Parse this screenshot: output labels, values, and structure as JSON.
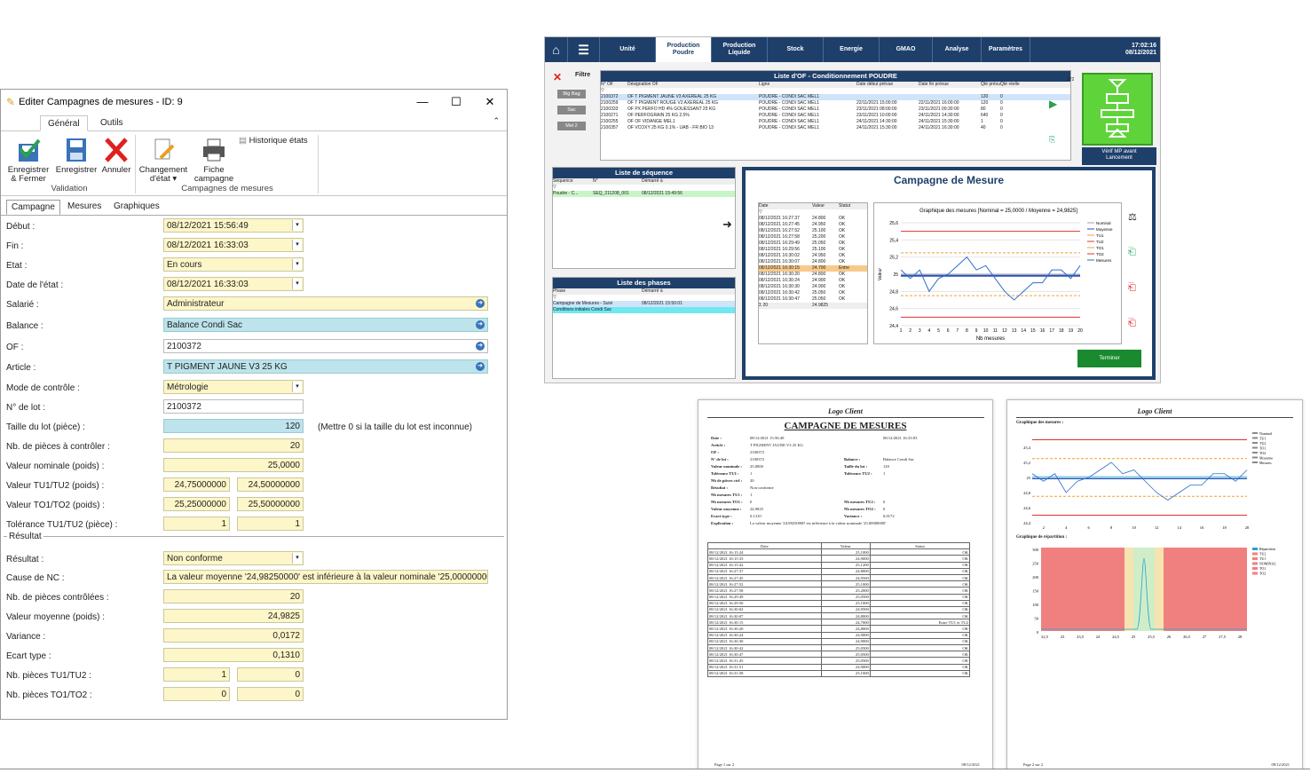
{
  "dialog": {
    "title": "Editer Campagnes de mesures - ID: 9",
    "ribbon_tabs": [
      "Général",
      "Outils"
    ],
    "buttons": {
      "save_close": "Enregistrer\n& Fermer",
      "save": "Enregistrer",
      "cancel": "Annuler",
      "change_state": "Changement\nd'état ▾",
      "campaign_sheet": "Fiche\ncampagne",
      "history": "Historique états"
    },
    "groups": {
      "validation": "Validation",
      "campaigns": "Campagnes de mesures"
    },
    "subtabs": [
      "Campagne",
      "Mesures",
      "Graphiques"
    ],
    "fields": {
      "debut": {
        "label": "Début :",
        "value": "08/12/2021 15:56:49"
      },
      "fin": {
        "label": "Fin :",
        "value": "08/12/2021 16:33:03"
      },
      "etat": {
        "label": "Etat :",
        "value": "En cours"
      },
      "date_etat": {
        "label": "Date de l'état :",
        "value": "08/12/2021 16:33:03"
      },
      "salarie": {
        "label": "Salarié :",
        "value": "Administrateur"
      },
      "balance": {
        "label": "Balance :",
        "value": "Balance Condi Sac"
      },
      "of": {
        "label": "OF :",
        "value": "2100372"
      },
      "article": {
        "label": "Article :",
        "value": "T PIGMENT JAUNE V3 25 KG"
      },
      "mode": {
        "label": "Mode de contrôle :",
        "value": "Métrologie"
      },
      "lot": {
        "label": "N° de lot :",
        "value": "2100372"
      },
      "taille": {
        "label": "Taille du lot (pièce) :",
        "value": "120",
        "hint": "(Mettre 0 si la taille du lot est inconnue)"
      },
      "nb_ctrl": {
        "label": "Nb. de pièces à contrôler :",
        "value": "20"
      },
      "nominale": {
        "label": "Valeur nominale (poids) :",
        "value": "25,0000"
      },
      "tu": {
        "label": "Valeur TU1/TU2 (poids) :",
        "v1": "24,75000000",
        "v2": "24,50000000"
      },
      "to": {
        "label": "Valeur TO1/TO2 (poids) :",
        "v1": "25,25000000",
        "v2": "25,50000000"
      },
      "tol": {
        "label": "Tolérance TU1/TU2 (pièce) :",
        "v1": "1",
        "v2": "1"
      }
    },
    "result_section": "Résultat",
    "results": {
      "resultat": {
        "label": "Résultat :",
        "value": "Non conforme"
      },
      "cause": {
        "label": "Cause de NC :",
        "value": "La valeur moyenne '24,98250000' est inférieure à la valeur nominale '25,00000000'."
      },
      "nb_ctrl": {
        "label": "Nb. de pièces contrôlées :",
        "value": "20"
      },
      "moy": {
        "label": "Valeur moyenne (poids) :",
        "value": "24,9825"
      },
      "var": {
        "label": "Variance :",
        "value": "0,0172"
      },
      "ecart": {
        "label": "Ecart type :",
        "value": "0,1310"
      },
      "ptu": {
        "label": "Nb. pièces TU1/TU2 :",
        "v1": "1",
        "v2": "0"
      },
      "pto": {
        "label": "Nb. pièces TO1/TO2 :",
        "v1": "0",
        "v2": "0"
      }
    }
  },
  "app": {
    "nav": [
      "Unité",
      "Production\nPoudre",
      "Production\nLiquide",
      "Stock",
      "Energie",
      "GMAO",
      "Analyse",
      "Paramètres"
    ],
    "clock": "17:02:16\n08/12/2021",
    "filter": "Filtre",
    "filter_btns": [
      "Big Bag",
      "Sac",
      "Mel 2"
    ],
    "of_title": "Liste d'OF - Conditionnement POUDRE",
    "of_cols": [
      "N° OF",
      "Désignation OF",
      "Ligne",
      "Date début prévue",
      "Date fin prévue",
      "Qté prévu...",
      "Qté réelle..."
    ],
    "of_rows": [
      [
        "2100372",
        "OF T PIGMENT JAUNE V3 AXEREAL 25 KG",
        "POUDRE - CONDI SAC MEL1",
        "",
        "",
        "120",
        "0"
      ],
      [
        "2100259",
        "OF T PIGMENT ROUGE V2 AXEREAL 25 KG",
        "POUDRE - CONDI SAC MEL1",
        "22/11/2021 15:00:00",
        "22/11/2021 16:00:00",
        "120",
        "0"
      ],
      [
        "2100333",
        "OF PX PERFO HD 4% GOUESSANT 25 KG",
        "POUDRE - CONDI SAC MEL1",
        "23/11/2021 08:00:00",
        "23/11/2021 09:30:00",
        "80",
        "0"
      ],
      [
        "2100271",
        "OF PERFOGRAIN 25 KG 2.5%",
        "POUDRE - CONDI SAC MEL1",
        "23/11/2021 10:00:00",
        "24/11/2021 14:30:00",
        "640",
        "0"
      ],
      [
        "2100255",
        "OF OF VIDANGE MEL1",
        "POUDRE - CONDI SAC MEL1",
        "24/11/2021 14:30:00",
        "24/11/2021 15:30:00",
        "1",
        "0"
      ],
      [
        "2100357",
        "OF VCOXY 25 KG 0.1% - UAB - FR BIO 13",
        "POUDRE - CONDI SAC MEL1",
        "24/11/2021 15:30:00",
        "24/11/2021 16:30:00",
        "40",
        "0"
      ]
    ],
    "of_count": "372",
    "verif": "Vérif MP avant\nLancement",
    "seq_title": "Liste de séquence",
    "seq_cols": [
      "Séquence",
      "N°",
      "Démarré à"
    ],
    "seq_row": [
      "Poudre - C...",
      "SEQ_211208_001",
      "08/12/2021 15:49:56"
    ],
    "phase_title": "Liste des phases",
    "phase_cols": [
      "Phase",
      "Démarré à"
    ],
    "phase_rows": [
      [
        "Campagne de Mesures - Suivi",
        "08/12/2021 15:50:01"
      ],
      [
        "Conditions initiales Condi Sac",
        ""
      ]
    ],
    "camp_title": "Campagne de Mesure",
    "meas_cols": [
      "Date",
      "Valeur",
      "Statut"
    ],
    "meas_rows": [
      [
        "08/12/2021 16:27:37",
        "24.800",
        "OK"
      ],
      [
        "08/12/2021 16:27:45",
        "24.950",
        "OK"
      ],
      [
        "08/12/2021 16:27:52",
        "25.100",
        "OK"
      ],
      [
        "08/12/2021 16:27:58",
        "25.200",
        "OK"
      ],
      [
        "08/12/2021 16:29:49",
        "25.050",
        "OK"
      ],
      [
        "08/12/2021 16:29:56",
        "25.100",
        "OK"
      ],
      [
        "08/12/2021 16:30:02",
        "24.950",
        "OK"
      ],
      [
        "08/12/2021 16:30:07",
        "24.800",
        "OK"
      ],
      [
        "08/12/2021 16:30:15",
        "24.700",
        "Entre"
      ],
      [
        "08/12/2021 16:30:20",
        "24.800",
        "OK"
      ],
      [
        "08/12/2021 16:30:24",
        "24.900",
        "OK"
      ],
      [
        "08/12/2021 16:30:30",
        "24.900",
        "OK"
      ],
      [
        "08/12/2021 16:30:42",
        "25.050",
        "OK"
      ],
      [
        "08/12/2021 16:30:47",
        "25.050",
        "OK"
      ]
    ],
    "meas_foot": [
      "20",
      "24.9825"
    ],
    "chart_title": "Graphique des mesures [Nominal = 25,0000 / Moyenne = 24,9825]",
    "chart_ylabel": "Valeur",
    "chart_xlabel": "Nb mesures",
    "legend": [
      "Nominal",
      "Moyenne",
      "TU1",
      "TU2",
      "TO1",
      "TO2",
      "Mesures"
    ],
    "terminer": "Terminer"
  },
  "chart_data": [
    {
      "type": "line",
      "title": "Graphique des mesures [Nominal = 25,0000 / Moyenne = 24,9825]",
      "xlabel": "Nb mesures",
      "ylabel": "Valeur",
      "x": [
        1,
        2,
        3,
        4,
        5,
        6,
        7,
        8,
        9,
        10,
        11,
        12,
        13,
        14,
        15,
        16,
        17,
        18,
        19,
        20
      ],
      "xticks": [
        "1",
        "2",
        "3",
        "4",
        "5",
        "6",
        "7",
        "8",
        "9",
        "10",
        "11",
        "12",
        "13",
        "14",
        "15",
        "16",
        "17",
        "18",
        "19",
        "20"
      ],
      "yticks": [
        "24,4",
        "24,6",
        "24,8",
        "25",
        "25,2",
        "25,4",
        "25,6"
      ],
      "ylim": [
        24.4,
        25.6
      ],
      "series": [
        {
          "name": "Mesures",
          "values": [
            25.05,
            24.95,
            25.05,
            24.8,
            24.95,
            25.0,
            25.1,
            25.2,
            25.05,
            25.1,
            24.95,
            24.8,
            24.7,
            24.8,
            24.9,
            24.9,
            25.05,
            25.05,
            24.95,
            25.1
          ]
        },
        {
          "name": "Nominal",
          "values": [
            25.0
          ]
        },
        {
          "name": "Moyenne",
          "values": [
            24.9825
          ]
        },
        {
          "name": "TU1",
          "values": [
            24.75
          ]
        },
        {
          "name": "TU2",
          "values": [
            24.5
          ]
        },
        {
          "name": "TO1",
          "values": [
            25.25
          ]
        },
        {
          "name": "TO2",
          "values": [
            25.5
          ]
        }
      ],
      "colors": {
        "Nominal": "#a0a0a0",
        "Moyenne": "#2a4fb5",
        "TU1": "#f0a030",
        "TU2": "#e03030",
        "TO1": "#f0a030",
        "TO2": "#e03030",
        "Mesures": "#2a6fd0"
      }
    }
  ],
  "report": {
    "logo": "Logo Client",
    "title": "CAMPAGNE DE MESURES",
    "info_left": [
      [
        "Date :",
        "08/12/2021 15:56:49"
      ],
      [
        "Article :",
        "T PIGMENT JAUNE V3 25 KG"
      ],
      [
        "OF :",
        "2100372"
      ],
      [
        "N° de lot :",
        "2100372"
      ],
      [
        "Valeur nominale :",
        "25,0000"
      ],
      [
        "Tolérance TU1 :",
        "1"
      ],
      [
        "Nb de pièces ctrl :",
        "20"
      ],
      [
        "Résultat :",
        "Non conforme"
      ],
      [
        "Nb mesures TU1 :",
        "1"
      ],
      [
        "Nb mesures TO1 :",
        "0"
      ],
      [
        "Valeur moyenne :",
        "24,9825"
      ],
      [
        "Ecart-type :",
        "0,1310"
      ],
      [
        "Explication :",
        "La valeur moyenne '24,98250000' est inférieure à la valeur nominale '25,00000000'"
      ]
    ],
    "info_right": [
      [
        "",
        "08/12/2021 16:33:03"
      ],
      [
        "Balance :",
        "Balance Condi Sac"
      ],
      [
        "Taille du lot :",
        "120"
      ],
      [
        "Tolérance TU2 :",
        "1"
      ],
      [
        "Nb mesures TU2 :",
        "0"
      ],
      [
        "Nb mesures TO2 :",
        "0"
      ],
      [
        "Variance :",
        "0,0172"
      ]
    ],
    "cols": [
      "Date",
      "Valeur",
      "Statut"
    ],
    "rows": [
      [
        "08/12/2021 16:15:24",
        "25,1000",
        "OK"
      ],
      [
        "08/12/2021 16:15:33",
        "24,9000",
        "OK"
      ],
      [
        "08/12/2021 16:15:42",
        "25,1200",
        "OK"
      ],
      [
        "08/12/2021 16:27:37",
        "24,8000",
        "OK"
      ],
      [
        "08/12/2021 16:27:45",
        "24,9500",
        "OK"
      ],
      [
        "08/12/2021 16:27:52",
        "25,1000",
        "OK"
      ],
      [
        "08/12/2021 16:27:58",
        "25,2000",
        "OK"
      ],
      [
        "08/12/2021 16:29:49",
        "25,0500",
        "OK"
      ],
      [
        "08/12/2021 16:29:56",
        "25,1000",
        "OK"
      ],
      [
        "08/12/2021 16:30:02",
        "24,9500",
        "OK"
      ],
      [
        "08/12/2021 16:30:07",
        "24,8000",
        "OK"
      ],
      [
        "08/12/2021 16:30:15",
        "24,7000",
        "Entre TU1 et TU2"
      ],
      [
        "08/12/2021 16:30:20",
        "24,8000",
        "OK"
      ],
      [
        "08/12/2021 16:30:24",
        "24,9000",
        "OK"
      ],
      [
        "08/12/2021 16:30:30",
        "24,9000",
        "OK"
      ],
      [
        "08/12/2021 16:30:42",
        "25,0500",
        "OK"
      ],
      [
        "08/12/2021 16:30:47",
        "25,0500",
        "OK"
      ],
      [
        "08/12/2021 16:31:45",
        "25,0500",
        "OK"
      ],
      [
        "08/12/2021 16:31:51",
        "24,9000",
        "OK"
      ],
      [
        "08/12/2021 16:31:58",
        "25,1000",
        "OK"
      ]
    ],
    "footer_left": "Page 1 sur 2",
    "footer_right": "08/12/2021",
    "p2_logo": "Logo Client",
    "p2_g1": "Graphique des mesures :",
    "p2_g2": "Graphique de répartition :",
    "p2_footer_left": "Page 2 sur 2",
    "p2_footer_right": "08/12/2021",
    "p2_legend1": [
      "Nominal",
      "TU1",
      "TU2",
      "TO1",
      "TO2",
      "Moyenne",
      "Mesures"
    ],
    "p2_legend2": [
      "Répartition",
      "TU2",
      "TU1",
      "NOMINAL",
      "TO1",
      "TO2"
    ]
  }
}
